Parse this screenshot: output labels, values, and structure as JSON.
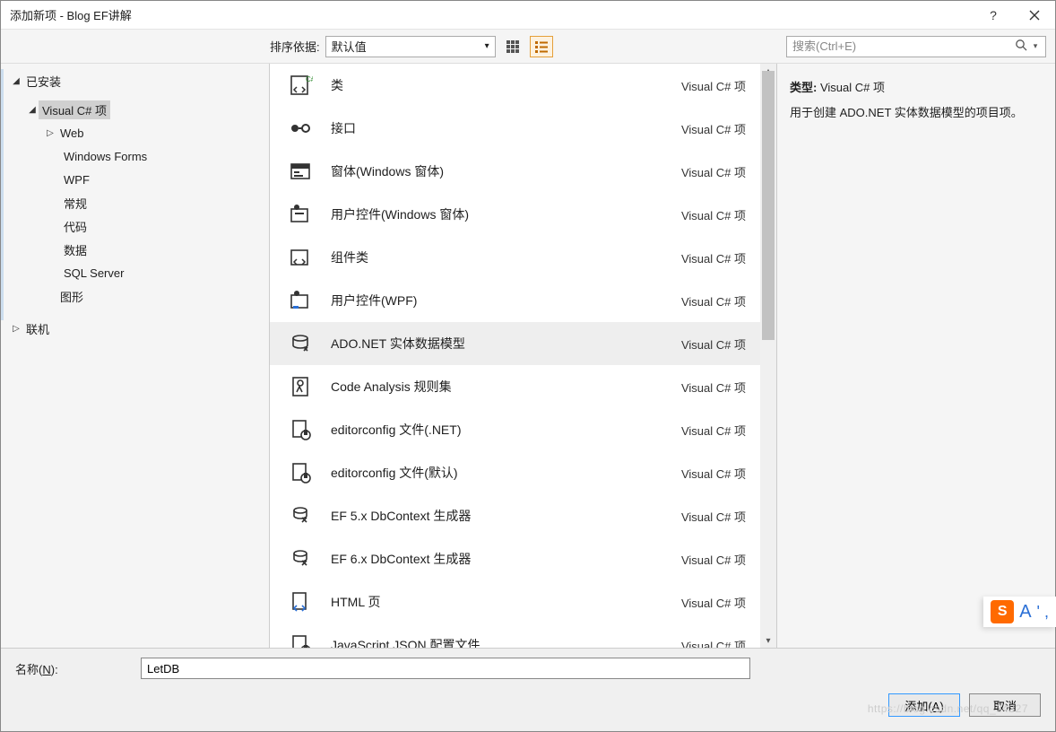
{
  "title": "添加新项 - Blog EF讲解",
  "help_tooltip": "?",
  "toolbar": {
    "sort_label": "排序依据:",
    "sort_value": "默认值",
    "search_placeholder": "搜索(Ctrl+E)"
  },
  "tree": {
    "installed": "已安装",
    "csharp": "Visual C# 项",
    "web": "Web",
    "winforms": "Windows Forms",
    "wpf": "WPF",
    "general": "常规",
    "code": "代码",
    "data": "数据",
    "sqlserver": "SQL Server",
    "graphics": "图形",
    "online": "联机"
  },
  "lang_label": "Visual C# 项",
  "templates": [
    {
      "name": "类"
    },
    {
      "name": "接口"
    },
    {
      "name": "窗体(Windows 窗体)"
    },
    {
      "name": "用户控件(Windows 窗体)"
    },
    {
      "name": "组件类"
    },
    {
      "name": "用户控件(WPF)"
    },
    {
      "name": "ADO.NET 实体数据模型"
    },
    {
      "name": "Code Analysis 规则集"
    },
    {
      "name": "editorconfig 文件(.NET)"
    },
    {
      "name": "editorconfig 文件(默认)"
    },
    {
      "name": "EF 5.x DbContext 生成器"
    },
    {
      "name": "EF 6.x DbContext 生成器"
    },
    {
      "name": "HTML 页"
    },
    {
      "name": "JavaScript JSON 配置文件"
    }
  ],
  "selected_index": 6,
  "desc": {
    "type_prefix": "类型:",
    "type_value": "Visual C# 项",
    "text": "用于创建 ADO.NET 实体数据模型的项目项。"
  },
  "name_field": {
    "label_pre": "名称(",
    "label_key": "N",
    "label_post": "):",
    "value": "LetDB"
  },
  "buttons": {
    "add_pre": "添加(",
    "add_key": "A",
    "add_post": ")",
    "cancel": "取消"
  },
  "watermark": "https://blog.csdn.net/qq_34327",
  "ime": {
    "s": "S",
    "mode": "A",
    "dots": "' ,"
  }
}
